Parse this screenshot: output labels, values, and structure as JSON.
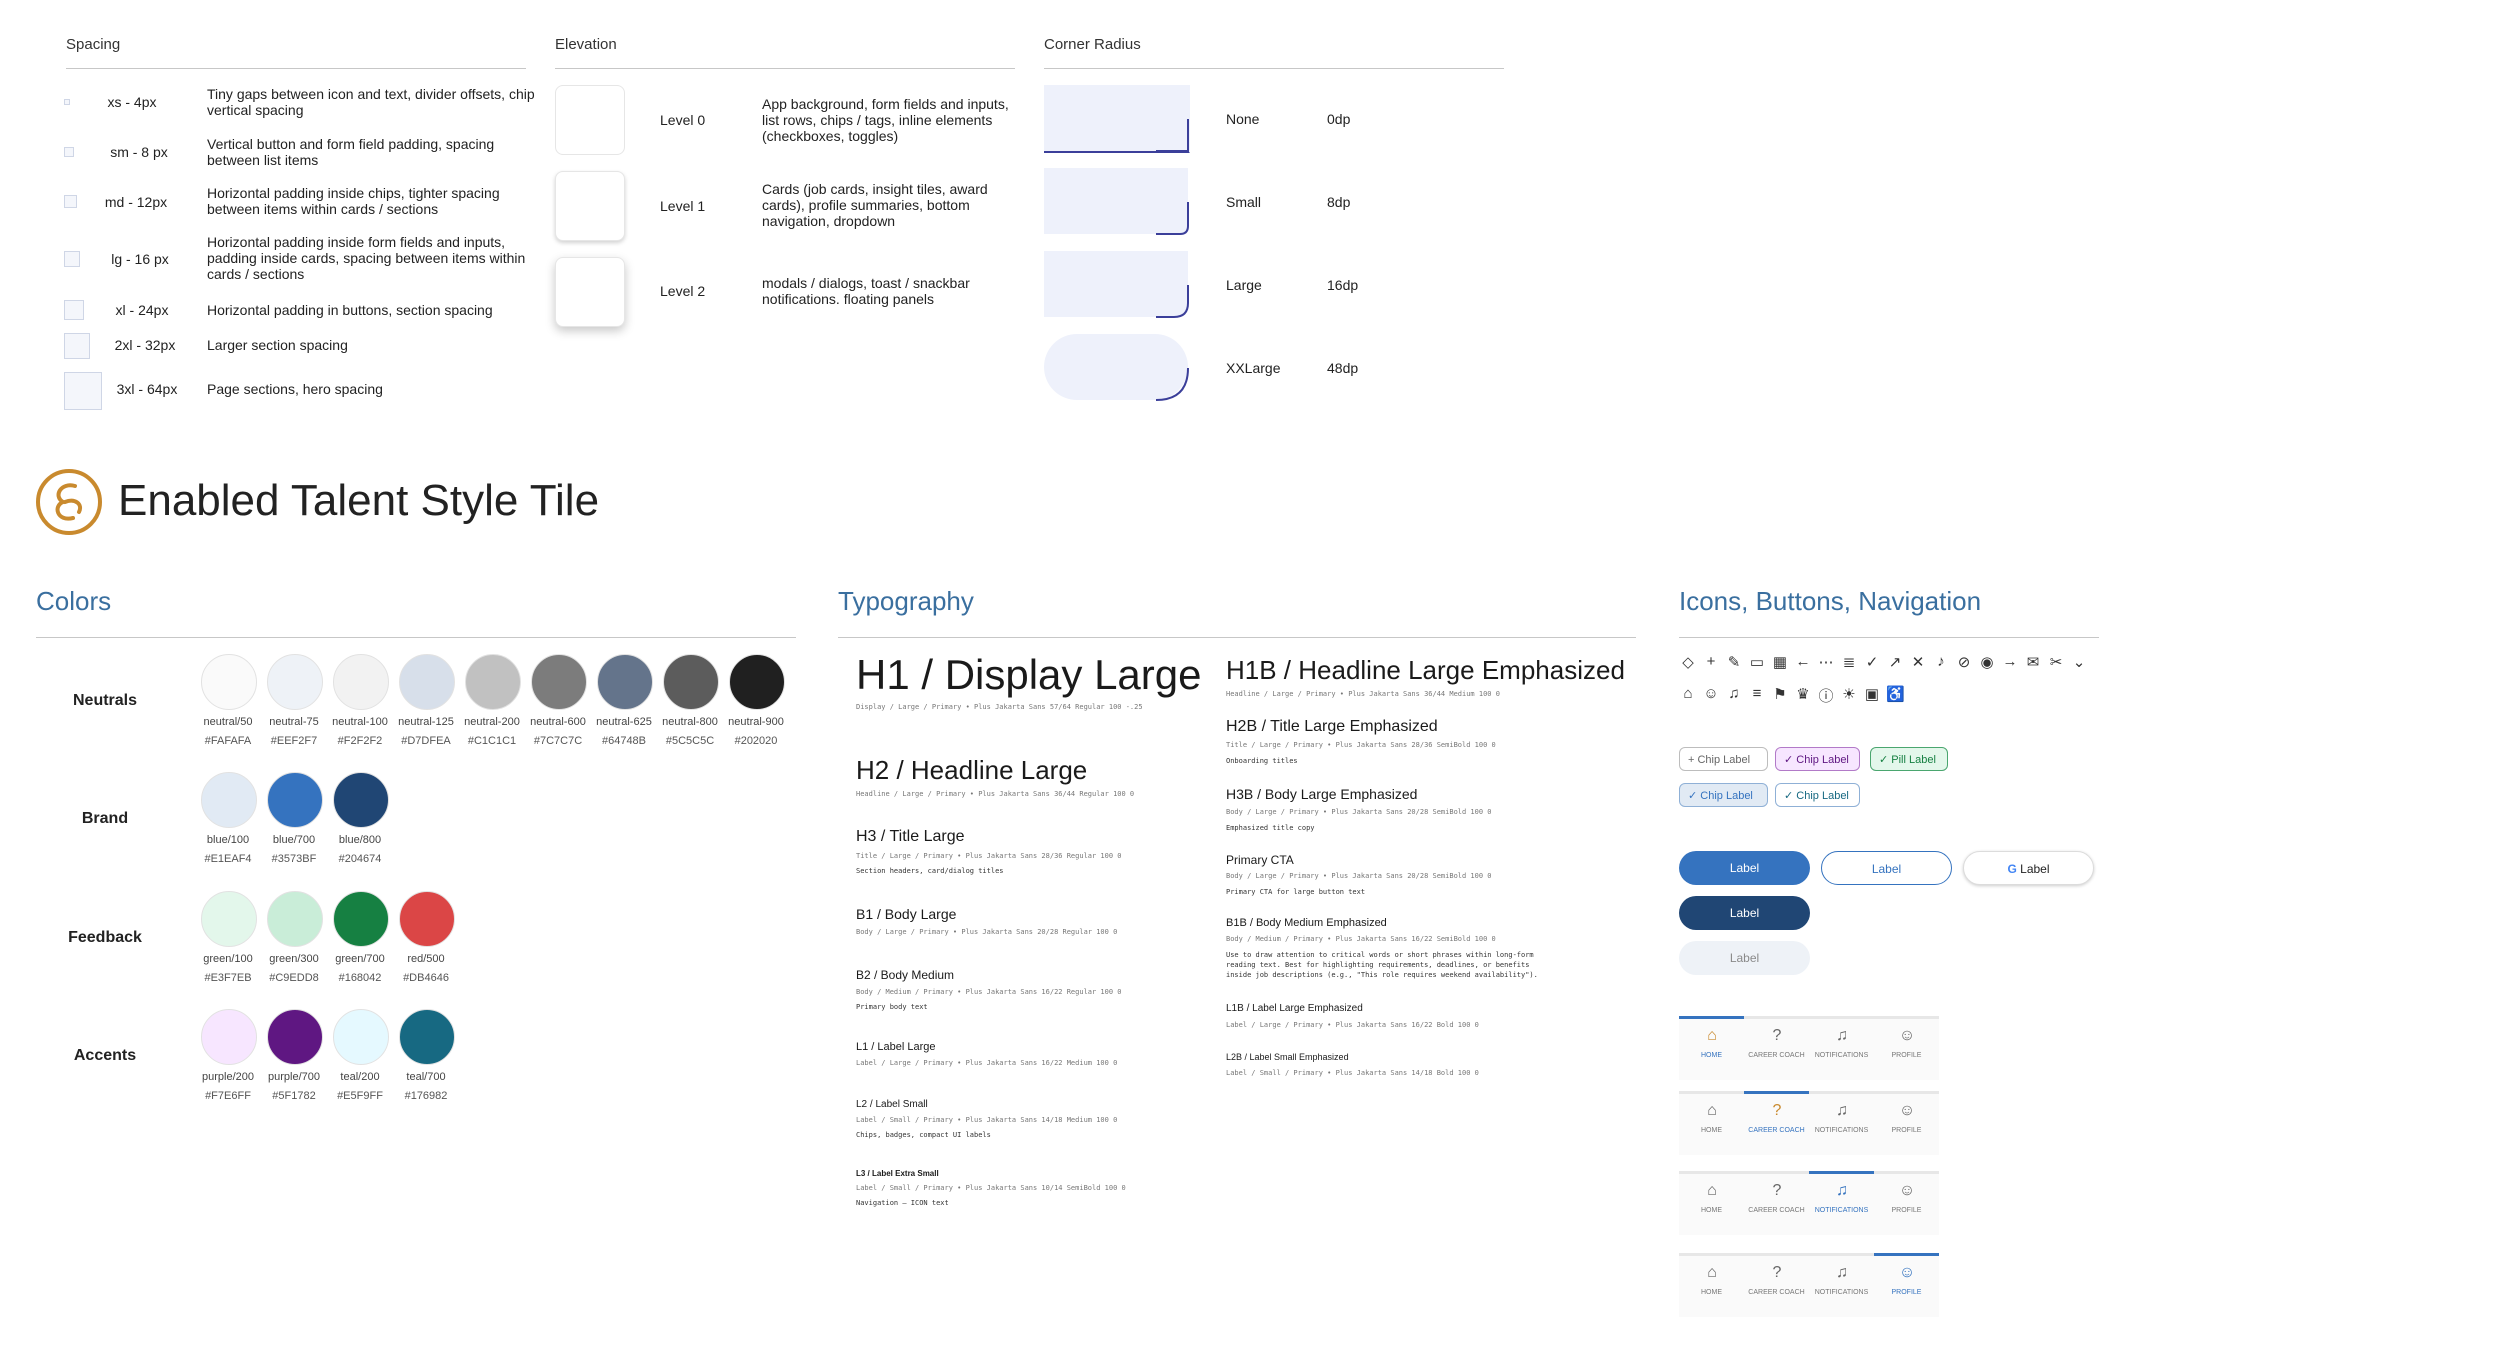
{
  "spacing": {
    "title": "Spacing",
    "items": [
      {
        "name": "xs - 4px",
        "desc": "Tiny gaps between icon and text, divider offsets, chip vertical spacing"
      },
      {
        "name": "sm - 8 px",
        "desc": "Vertical button and form field padding, spacing between list items"
      },
      {
        "name": "md - 12px",
        "desc": "Horizontal padding inside chips, tighter spacing between items within cards / sections"
      },
      {
        "name": "lg - 16 px",
        "desc": "Horizontal padding inside form fields and inputs, padding inside cards, spacing between items within cards / sections"
      },
      {
        "name": "xl - 24px",
        "desc": "Horizontal padding in buttons, section spacing"
      },
      {
        "name": "2xl - 32px",
        "desc": "Larger section spacing"
      },
      {
        "name": "3xl - 64px",
        "desc": "Page sections, hero spacing"
      }
    ]
  },
  "elevation": {
    "title": "Elevation",
    "items": [
      {
        "name": "Level 0",
        "desc": "App background, form fields and inputs, list rows, chips / tags, inline elements (checkboxes, toggles)"
      },
      {
        "name": "Level 1",
        "desc": "Cards (job cards, insight tiles, award cards), profile summaries, bottom navigation, dropdown"
      },
      {
        "name": "Level 2",
        "desc": "modals / dialogs, toast / snackbar notifications. floating panels"
      }
    ]
  },
  "corner_radius": {
    "title": "Corner Radius",
    "items": [
      {
        "name": "None",
        "value": "0dp"
      },
      {
        "name": "Small",
        "value": "8dp"
      },
      {
        "name": "Large",
        "value": "16dp"
      },
      {
        "name": "XXLarge",
        "value": "48dp"
      }
    ]
  },
  "brand_title": "Enabled Talent Style Tile",
  "colors": {
    "title": "Colors",
    "rows": [
      {
        "label": "Neutrals",
        "swatches": [
          {
            "name": "neutral/50",
            "hex": "#FAFAFA"
          },
          {
            "name": "neutral-75",
            "hex": "#EEF2F7"
          },
          {
            "name": "neutral-100",
            "hex": "#F2F2F2"
          },
          {
            "name": "neutral-125",
            "hex": "#D7DFEA"
          },
          {
            "name": "neutral-200",
            "hex": "#C1C1C1"
          },
          {
            "name": "neutral-600",
            "hex": "#7C7C7C"
          },
          {
            "name": "neutral-625",
            "hex": "#64748B"
          },
          {
            "name": "neutral-800",
            "hex": "#5C5C5C"
          },
          {
            "name": "neutral-900",
            "hex": "#202020"
          }
        ]
      },
      {
        "label": "Brand",
        "swatches": [
          {
            "name": "blue/100",
            "hex": "#E1EAF4"
          },
          {
            "name": "blue/700",
            "hex": "#3573BF"
          },
          {
            "name": "blue/800",
            "hex": "#204674"
          }
        ]
      },
      {
        "label": "Feedback",
        "swatches": [
          {
            "name": "green/100",
            "hex": "#E3F7EB"
          },
          {
            "name": "green/300",
            "hex": "#C9EDD8"
          },
          {
            "name": "green/700",
            "hex": "#168042"
          },
          {
            "name": "red/500",
            "hex": "#DB4646"
          }
        ]
      },
      {
        "label": "Accents",
        "swatches": [
          {
            "name": "purple/200",
            "hex": "#F7E6FF"
          },
          {
            "name": "purple/700",
            "hex": "#5F1782"
          },
          {
            "name": "teal/200",
            "hex": "#E5F9FF"
          },
          {
            "name": "teal/700",
            "hex": "#176982"
          }
        ]
      }
    ]
  },
  "typography": {
    "title": "Typography",
    "left": [
      {
        "title": "H1 / Display Large",
        "spec": "Display / Large / Primary  •  Plus Jakarta Sans  57/64  Regular  100  -.25",
        "note": ""
      },
      {
        "title": "H2 / Headline Large",
        "spec": "Headline / Large / Primary  •  Plus Jakarta Sans  36/44  Regular  100  0",
        "note": ""
      },
      {
        "title": "H3 / Title Large",
        "spec": "Title / Large / Primary  •  Plus Jakarta Sans  28/36  Regular  100  0",
        "note": "Section headers, card/dialog titles"
      },
      {
        "title": "B1 / Body Large",
        "spec": "Body / Large / Primary  •  Plus Jakarta Sans  20/28  Regular  100  0",
        "note": ""
      },
      {
        "title": "B2 / Body Medium",
        "spec": "Body / Medium / Primary  •  Plus Jakarta Sans  16/22  Regular  100  0",
        "note": "Primary body text"
      },
      {
        "title": "L1 / Label Large",
        "spec": "Label / Large / Primary  •  Plus Jakarta Sans  16/22  Medium  100  0",
        "note": ""
      },
      {
        "title": "L2 / Label Small",
        "spec": "Label / Small / Primary  •  Plus Jakarta Sans  14/18  Medium  100  0",
        "note": "Chips, badges, compact UI labels"
      },
      {
        "title": "L3 / Label Extra Small",
        "spec": "Label / Small / Primary  •  Plus Jakarta Sans  10/14  SemiBold  100  0",
        "note": "Navigation – ICON text"
      }
    ],
    "right": [
      {
        "title": "H1B / Headline Large Emphasized",
        "spec": "Headline / Large / Primary  •  Plus Jakarta Sans  36/44  Medium  100  0",
        "note": ""
      },
      {
        "title": "H2B / Title Large Emphasized",
        "spec": "Title / Large / Primary  •  Plus Jakarta Sans  28/36  SemiBold  100  0",
        "note": "Onboarding titles"
      },
      {
        "title": "H3B / Body Large Emphasized",
        "spec": "Body / Large / Primary  •  Plus Jakarta Sans  20/28  SemiBold  100  0",
        "note": "Emphasized title copy"
      },
      {
        "title": "Primary CTA",
        "spec": "Body / Large / Primary  •  Plus Jakarta Sans  20/28  SemiBold  100  0",
        "note": "Primary CTA for large button text"
      },
      {
        "title": "B1B / Body Medium Emphasized",
        "spec": "Body / Medium / Primary  •  Plus Jakarta Sans  16/22  SemiBold  100  0",
        "note": "Use to draw attention to critical words or short phrases within long-form",
        "note2": "reading text. Best for highlighting requirements, deadlines, or benefits",
        "note3": "inside job descriptions (e.g., \"This role requires weekend availability\")."
      },
      {
        "title": "L1B / Label Large Emphasized",
        "spec": "Label / Large / Primary  •  Plus Jakarta Sans  16/22  Bold  100  0",
        "note": ""
      },
      {
        "title": "L2B / Label Small Emphasized",
        "spec": "Label / Small / Primary  •  Plus Jakarta Sans  14/18  Bold  100  0",
        "note": ""
      }
    ]
  },
  "icons_section": {
    "title": "Icons, Buttons, Navigation",
    "row1": [
      "diamond-icon",
      "plus-icon",
      "pencil-icon",
      "clipboard-icon",
      "calendar-icon",
      "arrow-left-icon",
      "more-icon",
      "document-icon",
      "check-icon",
      "external-link-icon",
      "close-icon",
      "mic-icon",
      "eye-off-icon",
      "eye-icon",
      "arrow-right-icon",
      "mail-icon",
      "tools-icon",
      "chevron-down-icon"
    ],
    "row2": [
      "home-icon",
      "account-icon",
      "bell-icon",
      "storage-icon",
      "bookmark-icon",
      "trophy-icon",
      "info-circle-icon",
      "lightbulb-icon",
      "id-card-icon",
      "accessibility-icon"
    ],
    "chips": {
      "chip1": "Chip Label",
      "chip2": "Chip Label",
      "chip3": "Pill Label",
      "chip4": "Chip Label",
      "chip5": "Chip Label"
    },
    "buttons": {
      "primary": "Label",
      "outline": "Label",
      "google": "Label",
      "dark": "Label",
      "disabled": "Label"
    },
    "nav": {
      "labels": [
        "HOME",
        "CAREER COACH",
        "NOTIFICATIONS",
        "PROFILE"
      ],
      "active_color": "#3A78C9"
    }
  },
  "colors_accent": {
    "brand_orange": "#C98A2E",
    "heading_blue": "#3A6F9F"
  }
}
